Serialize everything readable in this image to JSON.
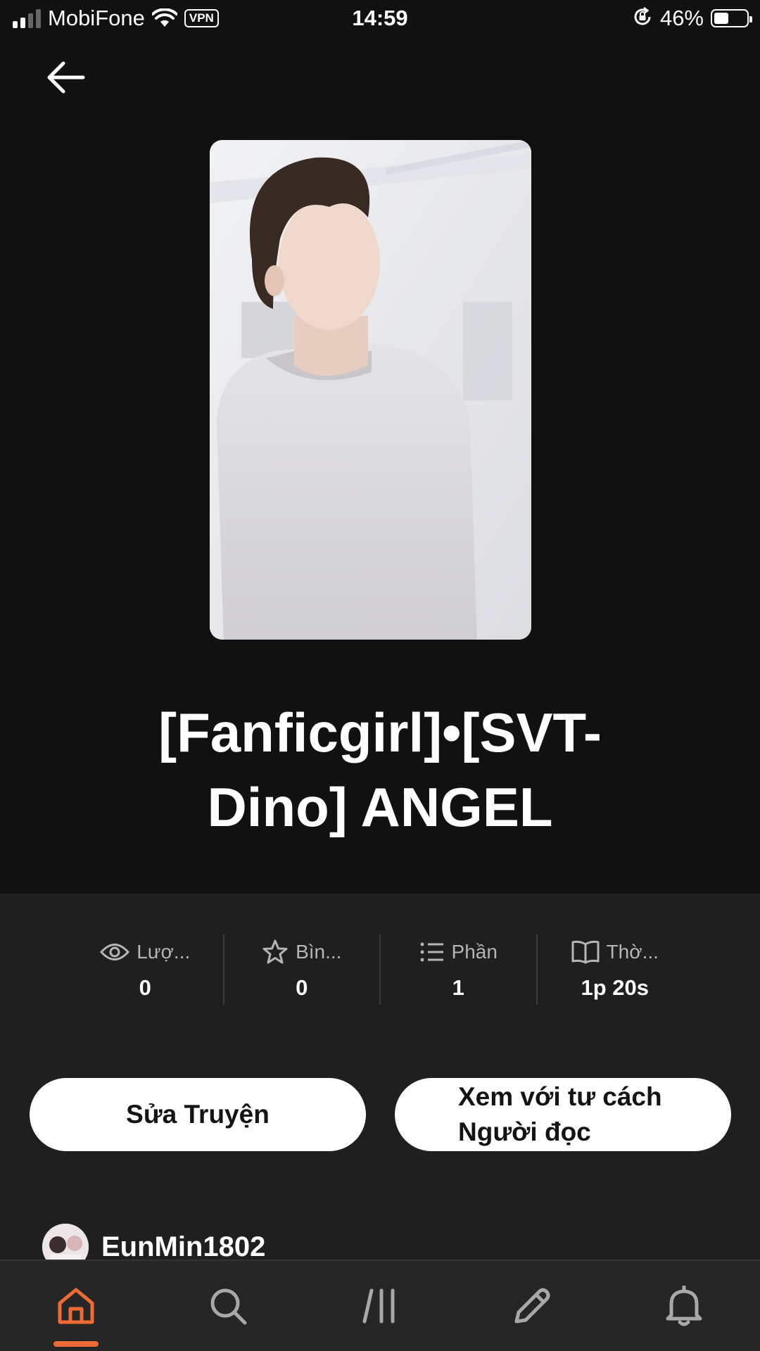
{
  "status_bar": {
    "carrier": "MobiFone",
    "vpn": "VPN",
    "time": "14:59",
    "battery": "46%",
    "battery_level": 0.46
  },
  "story": {
    "title": "[Fanficgirl]•[SVT-Dino] ANGEL"
  },
  "stats": [
    {
      "icon": "eye-icon",
      "label": "Lượ...",
      "value": "0"
    },
    {
      "icon": "star-icon",
      "label": "Bìn...",
      "value": "0"
    },
    {
      "icon": "list-icon",
      "label": "Phần",
      "value": "1"
    },
    {
      "icon": "book-icon",
      "label": "Thờ...",
      "value": "1p 20s"
    }
  ],
  "actions": {
    "edit_label": "Sửa Truyện",
    "reader_line1": "Xem với tư cách",
    "reader_line2": "Người đọc"
  },
  "author": {
    "name": "EunMin1802"
  },
  "nav": {
    "items": [
      "home-icon",
      "search-icon",
      "library-icon",
      "write-icon",
      "bell-icon"
    ],
    "active": "home-icon"
  },
  "colors": {
    "accent": "#ee6b35",
    "background": "#111111",
    "panel": "#1f1f1f",
    "nav_bg": "#262626",
    "icon_inactive": "#a8a8a8"
  }
}
